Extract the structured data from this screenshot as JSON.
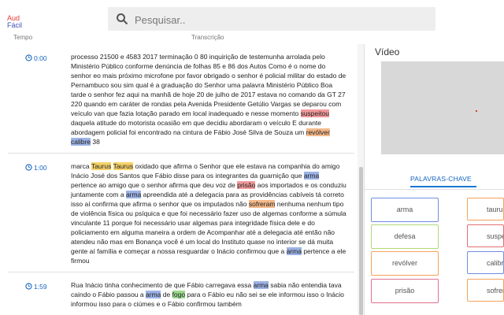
{
  "app": {
    "logo_line1": "Aud",
    "logo_line2": "Fácil"
  },
  "search": {
    "placeholder": "Pesquisar.."
  },
  "columns": {
    "time": "Tempo",
    "transcript": "Transcrição"
  },
  "segments": [
    {
      "time": "0:00",
      "parts": [
        {
          "t": "processo 21500 e 4583 2017 terminação 0 80 inquirição de testemunha arrolada pelo Ministério Público conforme denúncia de folhas 85 e 86 dos Autos Como é o nome do senhor eo mais próximo microfone por favor obrigado o senhor é policial militar do estado de Pernambuco sou sim qual é a graduação do Senhor uma palavra Ministério Público Boa tarde o senhor fez aqui na manhã de hoje 20 de julho de 2017 estava no comando da GT 27 220 quando em caráter de rondas pela Avenida Presidente Getúlio Vargas se deparou com veículo van que fazia lotação parado em local inadequado e nesse momento "
        },
        {
          "t": "suspeitou",
          "h": "red"
        },
        {
          "t": " daquela atitude do motorista ocasião em que decidiu abordaram o veículo E durante abordagem policial foi encontrado na cintura de Fábio José Silva de Souza um "
        },
        {
          "t": "revólver",
          "h": "orange"
        },
        {
          "t": " "
        },
        {
          "t": "calibre",
          "h": "blue"
        },
        {
          "t": " 38"
        }
      ]
    },
    {
      "time": "1:00",
      "parts": [
        {
          "t": "marca "
        },
        {
          "t": "Taurus",
          "h": "yellow"
        },
        {
          "t": " "
        },
        {
          "t": "Taurus",
          "h": "yellow"
        },
        {
          "t": " oxidado que afirma o Senhor que ele estava na companhia do amigo Inácio José dos Santos que Fábio disse para os integrantes da guarnição que "
        },
        {
          "t": "arma",
          "h": "blue"
        },
        {
          "t": " pertence ao amigo que o senhor afirma que deu voz de "
        },
        {
          "t": "prisão",
          "h": "red"
        },
        {
          "t": " aos importados e os conduziu juntamente com a "
        },
        {
          "t": "arma",
          "h": "blue"
        },
        {
          "t": " apreendida até a delegacia para as providências cabíveis tá correto isso aí confirma que afirma o senhor que os imputados não "
        },
        {
          "t": "sofreram",
          "h": "orange"
        },
        {
          "t": " nenhuma nenhum tipo de violência física ou psíquica e que foi necessário fazer uso de algemas conforme a súmula vinculante 11 porque foi necessário usar algemas para integridade física dele e do policiamento em alguma maneira a ordem de Acompanhar até a delegacia até então não atendeu não mas em Bonança você é um local do Instituto quase no interior se dá muita gente aí família e começar a nossa resguardar o Inácio confirmou que a "
        },
        {
          "t": "arma",
          "h": "blue"
        },
        {
          "t": " pertence a ele firmou"
        }
      ]
    },
    {
      "time": "1:59",
      "parts": [
        {
          "t": "Rua Inácio tinha conhecimento de que Fábio carregava essa "
        },
        {
          "t": "arma",
          "h": "blue"
        },
        {
          "t": " sabia não entendia tava caindo o Fábio passou a "
        },
        {
          "t": "arma",
          "h": "blue"
        },
        {
          "t": " de "
        },
        {
          "t": "fogo",
          "h": "green"
        },
        {
          "t": " para o Fábio eu não sei se ele informou isso o Inácio informou isso para o ciúmes e o Fábio confirmou também"
        }
      ]
    }
  ],
  "video": {
    "title": "Vídeo"
  },
  "tabs": [
    {
      "label": "PALAVRAS-CHAVE"
    }
  ],
  "keywords": [
    {
      "label": "arma",
      "color": "#6f8ee0"
    },
    {
      "label": "taurus",
      "color": "#f4a25a"
    },
    {
      "label": "defesa",
      "color": "#b2d87a"
    },
    {
      "label": "suspeitou",
      "color": "#e07070"
    },
    {
      "label": "revólver",
      "color": "#f4a25a"
    },
    {
      "label": "calibre",
      "color": "#6f8ee0"
    },
    {
      "label": "prisão",
      "color": "#e07090"
    },
    {
      "label": "sofreram",
      "color": "#f4a25a"
    }
  ]
}
